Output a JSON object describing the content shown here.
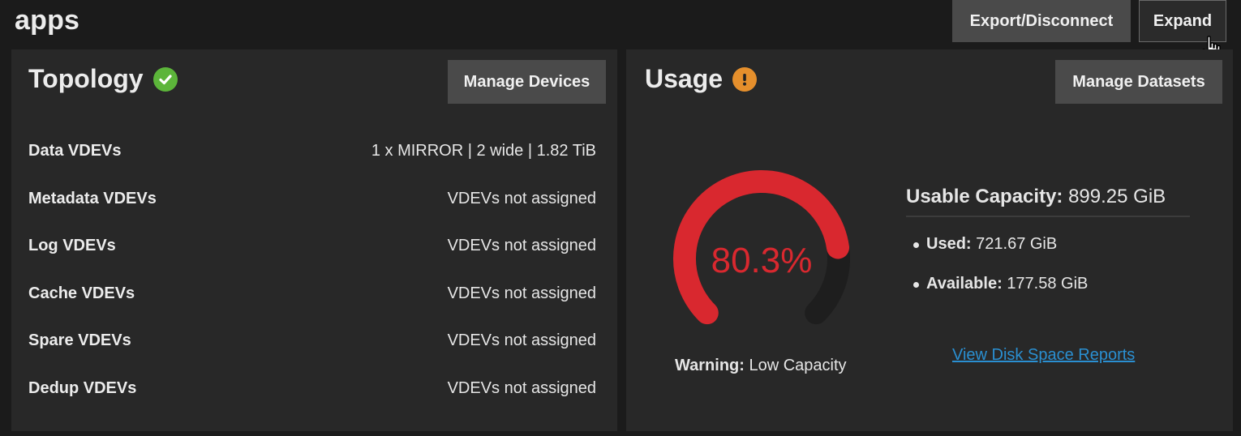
{
  "pool": {
    "name": "apps"
  },
  "header": {
    "export_label": "Export/Disconnect",
    "expand_label": "Expand"
  },
  "topology": {
    "title": "Topology",
    "status": "ok",
    "manage_label": "Manage Devices",
    "rows": [
      {
        "label": "Data VDEVs",
        "value": "1 x MIRROR | 2 wide | 1.82 TiB"
      },
      {
        "label": "Metadata VDEVs",
        "value": "VDEVs not assigned"
      },
      {
        "label": "Log VDEVs",
        "value": "VDEVs not assigned"
      },
      {
        "label": "Cache VDEVs",
        "value": "VDEVs not assigned"
      },
      {
        "label": "Spare VDEVs",
        "value": "VDEVs not assigned"
      },
      {
        "label": "Dedup VDEVs",
        "value": "VDEVs not assigned"
      }
    ]
  },
  "usage": {
    "title": "Usage",
    "status": "warning",
    "manage_label": "Manage Datasets",
    "gauge_percent_text": "80.3%",
    "gauge_fraction": 0.803,
    "warning_label": "Warning:",
    "warning_text": "Low Capacity",
    "capacity_label": "Usable Capacity:",
    "capacity_value": "899.25 GiB",
    "used_label": "Used:",
    "used_value": "721.67 GiB",
    "available_label": "Available:",
    "available_value": "177.58 GiB",
    "report_link": "View Disk Space Reports"
  },
  "colors": {
    "gauge_fill": "#d9282f",
    "gauge_track": "#1e1e1e",
    "ok": "#5cb53a",
    "warning": "#e58f2c",
    "link": "#2a8fd1"
  }
}
